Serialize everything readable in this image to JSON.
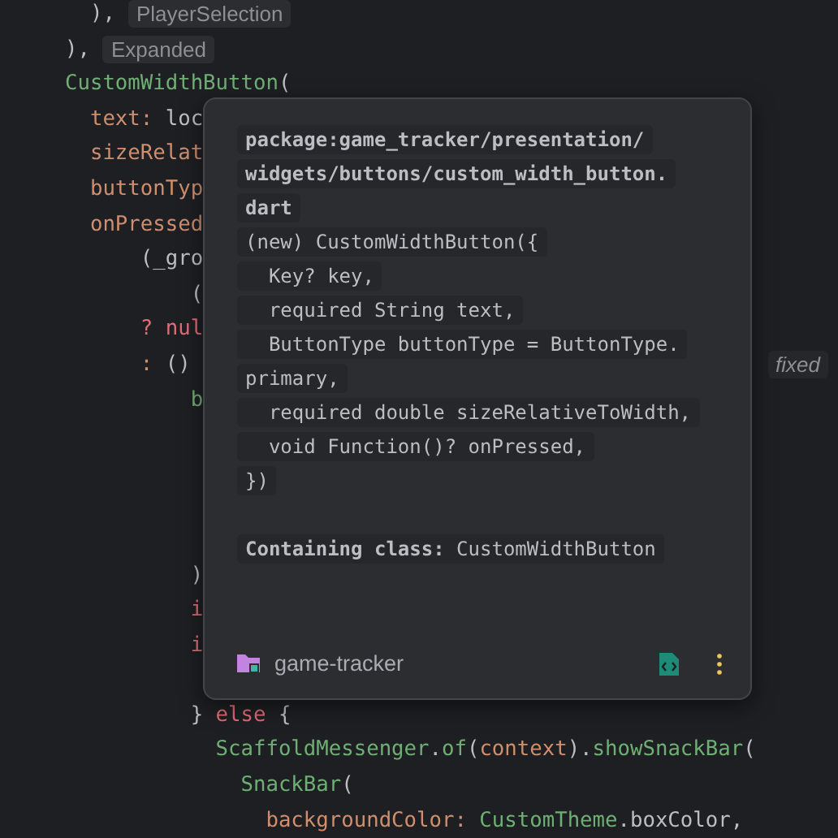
{
  "editor": {
    "lines": [
      {
        "kind": "code",
        "segments": [
          {
            "text": "  ),",
            "kind": "plain"
          }
        ],
        "hint": {
          "text": "PlayerSelection",
          "kind": "label"
        }
      },
      {
        "kind": "code",
        "segments": [
          {
            "text": "),",
            "kind": "plain"
          }
        ],
        "hint": {
          "text": "Expanded",
          "kind": "label"
        }
      },
      {
        "kind": "code",
        "segments": [
          {
            "text": "CustomWidthButton",
            "kind": "fn"
          },
          {
            "text": "(",
            "kind": "plain"
          }
        ]
      },
      {
        "kind": "code",
        "segments": [
          {
            "text": "  text:",
            "kind": "param"
          },
          {
            "text": " loc",
            "kind": "plain"
          }
        ]
      },
      {
        "kind": "code",
        "segments": [
          {
            "text": "  sizeRelat",
            "kind": "param"
          }
        ]
      },
      {
        "kind": "code",
        "segments": [
          {
            "text": "  buttonTyp",
            "kind": "param"
          }
        ]
      },
      {
        "kind": "code",
        "segments": [
          {
            "text": "  onPressed",
            "kind": "param"
          }
        ]
      },
      {
        "kind": "code",
        "segments": [
          {
            "text": "      (_gro",
            "kind": "plain"
          }
        ]
      },
      {
        "kind": "code",
        "segments": [
          {
            "text": "          (",
            "kind": "plain"
          }
        ]
      },
      {
        "kind": "code",
        "segments": [
          {
            "text": "      ? nul",
            "kind": "kw"
          }
        ]
      },
      {
        "kind": "code",
        "segments": [
          {
            "text": "      :",
            "kind": "param"
          },
          {
            "text": " ()",
            "kind": "plain"
          }
        ],
        "hint": {
          "text": "fixed",
          "kind": "type"
        }
      },
      {
        "kind": "code",
        "segments": [
          {
            "text": "          b",
            "kind": "fn"
          }
        ]
      },
      {
        "kind": "blank"
      },
      {
        "kind": "blank"
      },
      {
        "kind": "blank"
      },
      {
        "kind": "blank"
      },
      {
        "kind": "code",
        "segments": [
          {
            "text": "          )",
            "kind": "plain"
          }
        ]
      },
      {
        "kind": "code",
        "segments": [
          {
            "text": "          i",
            "kind": "kw"
          }
        ]
      },
      {
        "kind": "code",
        "segments": [
          {
            "text": "          i",
            "kind": "kw"
          }
        ]
      },
      {
        "kind": "blank"
      },
      {
        "kind": "code",
        "segments": [
          {
            "text": "          }",
            "kind": "plain"
          },
          {
            "text": " else",
            "kind": "kw"
          },
          {
            "text": " {",
            "kind": "plain"
          }
        ]
      },
      {
        "kind": "code",
        "segments": [
          {
            "text": "            ScaffoldMessenger",
            "kind": "fn"
          },
          {
            "text": ".",
            "kind": "plain"
          },
          {
            "text": "of",
            "kind": "fn"
          },
          {
            "text": "(",
            "kind": "plain"
          },
          {
            "text": "context",
            "kind": "param"
          },
          {
            "text": ").",
            "kind": "plain"
          },
          {
            "text": "showSnackBar",
            "kind": "fn"
          },
          {
            "text": "(",
            "kind": "plain"
          }
        ]
      },
      {
        "kind": "code",
        "segments": [
          {
            "text": "              SnackBar",
            "kind": "fn"
          },
          {
            "text": "(",
            "kind": "plain"
          }
        ]
      },
      {
        "kind": "code",
        "segments": [
          {
            "text": "                backgroundColor:",
            "kind": "param"
          },
          {
            "text": " CustomTheme",
            "kind": "fn"
          },
          {
            "text": ".boxColor,",
            "kind": "plain"
          }
        ]
      }
    ]
  },
  "popup": {
    "doc_lines": [
      {
        "text": "package:game_tracker/presentation/",
        "kind": "path"
      },
      {
        "text": "widgets/buttons/custom_width_button.",
        "kind": "path"
      },
      {
        "text": "dart",
        "kind": "path"
      },
      {
        "text": "(new) CustomWidthButton({",
        "kind": "code"
      },
      {
        "text": "  Key? key,",
        "kind": "code"
      },
      {
        "text": "  required String text,",
        "kind": "code"
      },
      {
        "text": "  ButtonType buttonType = ButtonType.",
        "kind": "code"
      },
      {
        "text": "primary,",
        "kind": "code"
      },
      {
        "text": "  required double sizeRelativeToWidth,",
        "kind": "code"
      },
      {
        "text": "  void Function()? onPressed,",
        "kind": "code"
      },
      {
        "text": "})",
        "kind": "code"
      },
      {
        "text": "**Containing class:** CustomWidthButton",
        "kind": "note"
      }
    ],
    "project": "game-tracker"
  }
}
